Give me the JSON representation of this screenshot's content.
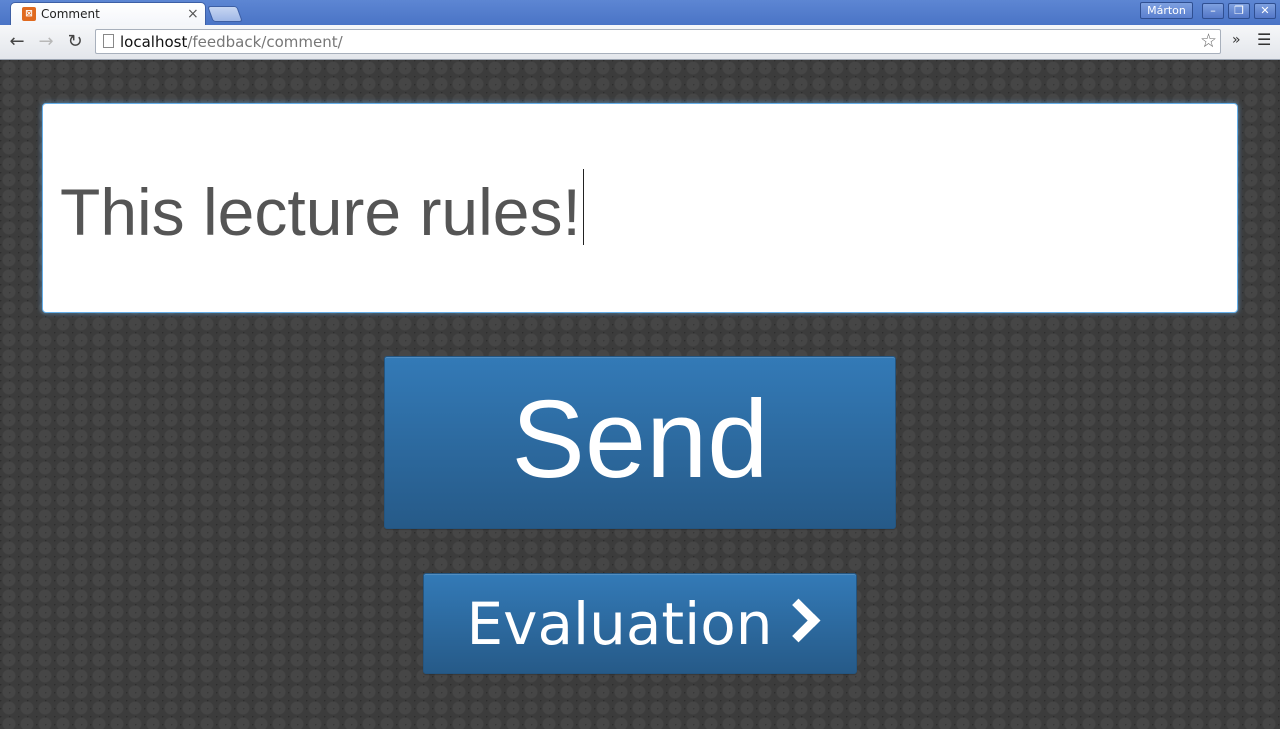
{
  "browser": {
    "tab_title": "Comment",
    "tab_close": "×",
    "tab_favicon": "xampp-icon",
    "profile_name": "Márton",
    "window_controls": {
      "minimize": "–",
      "restore": "❐",
      "close": "✕"
    },
    "nav": {
      "back": "←",
      "forward": "→",
      "reload": "↻"
    },
    "url_host": "localhost",
    "url_path": "/feedback/comment/",
    "bookmark_star": "☆",
    "extensions_overflow": "»",
    "menu": "☰"
  },
  "page": {
    "comment_value": "This lecture rules!",
    "send_label": "Send",
    "evaluation_label": "Evaluation",
    "colors": {
      "button_primary": "#337ab7",
      "focus_border": "#66afe9"
    }
  }
}
